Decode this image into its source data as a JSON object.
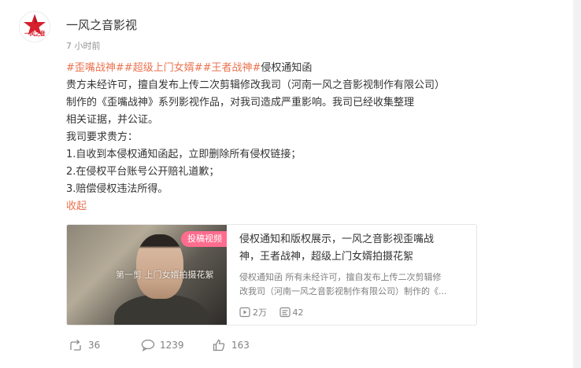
{
  "user": {
    "name": "一风之音影视",
    "avatar_text": "一风之音",
    "time": "7 小时前"
  },
  "post": {
    "tags": [
      "#歪嘴战神#",
      "#超级上门女婿#",
      "#王者战神#"
    ],
    "headline": "侵权通知函",
    "lines": [
      "贵方未经许可，擅自发布上传二次剪辑修改我司（河南一风之音影视制作有限公司）",
      "制作的《歪嘴战神》系列影视作品，对我司造成严重影响。我司已经收集整理",
      "相关证据，并公证。",
      "我司要求贵方：",
      "1.自收到本侵权通知函起，立即删除所有侵权链接；",
      "2.在侵权平台账号公开赔礼道歉；",
      "3.赔偿侵权违法所得。"
    ],
    "collapse_label": "收起"
  },
  "media": {
    "badge": "投稿视频",
    "thumb_caption": "第一剪 上门女婿拍摄花絮",
    "title_lines": [
      "侵权通知和版权展示，一风之音影视歪嘴战",
      "神，王者战神，超级上门女婿拍摄花絮"
    ],
    "desc_lines": [
      "侵权通知函 所有未经许可，擅自发布上传二次剪辑修",
      "改我司（河南一风之音影视制作有限公司）制作的《..."
    ],
    "plays": "2万",
    "danmaku": "42"
  },
  "actions": {
    "reposts": "36",
    "comments": "1239",
    "likes": "163"
  },
  "colors": {
    "accent": "#eb7350",
    "brand": "#d6202d",
    "badge": "#ff6c8e"
  }
}
